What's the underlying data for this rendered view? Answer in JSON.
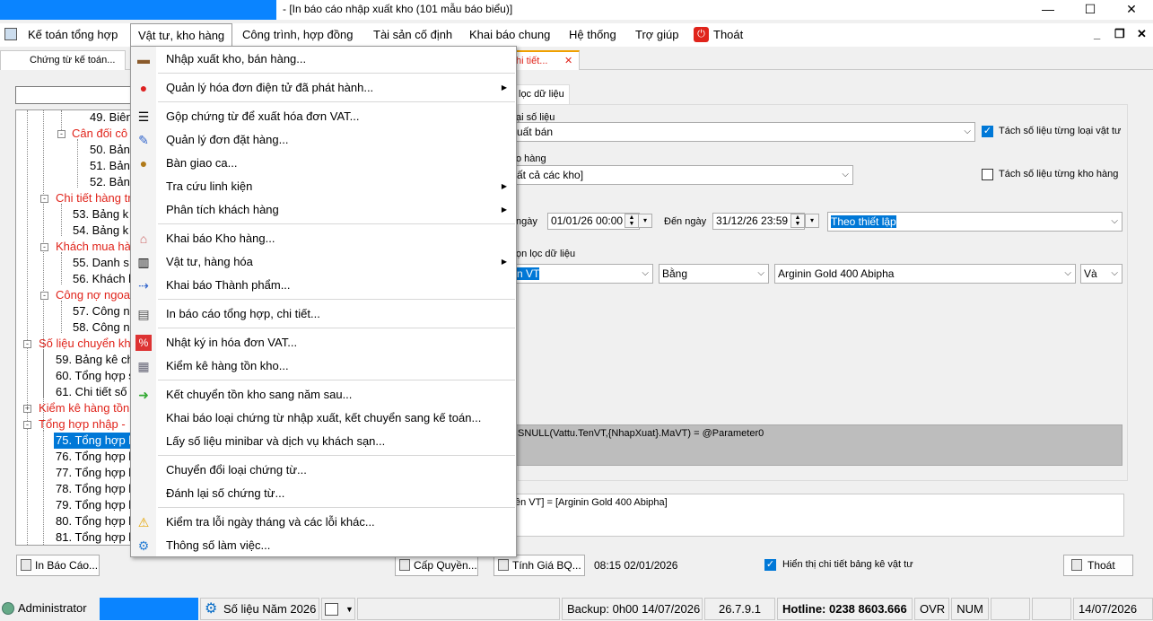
{
  "window": {
    "title": "- [In báo cáo nhập xuất kho (101 mẫu báo biểu)]",
    "minimize": "—",
    "maximize": "☐",
    "close": "✕"
  },
  "menubar": {
    "items": [
      "Kế toán tổng hợp",
      "Vật tư, kho hàng",
      "Công trình, hợp đồng",
      "Tài sản cố định",
      "Khai báo chung",
      "Hệ thống",
      "Trợ giúp",
      "Thoát"
    ],
    "mdi": [
      "_",
      "❐",
      "✕"
    ]
  },
  "tabs": {
    "first": "Chứng từ kế toán...",
    "second": "hi tiết...",
    "close": "✕"
  },
  "tree": {
    "nodes": [
      "49. Biên",
      "Cân đối cô",
      "50. Bản",
      "51. Bản",
      "52. Bản",
      "Chi tiết hàng tr",
      "53. Bảng k",
      "54. Bảng k",
      "Khách mua hà",
      "55. Danh s",
      "56. Khách l",
      "Công nợ ngoa",
      "57. Công n",
      "58. Công n",
      "Số liệu chuyển kh",
      "59. Bảng kê ch",
      "60. Tổng hợp s",
      "61. Chi tiết số l",
      "Kiểm kê hàng tồn",
      "Tổng hợp nhập - ",
      "75. Tổng hợp l",
      "76. Tổng hợp l",
      "77. Tổng hợp l",
      "78. Tổng hợp l",
      "79. Tổng hợp l",
      "80. Tổng hợp l",
      "81. Tổng hợp l"
    ]
  },
  "dropdown": {
    "items": [
      "Nhập xuất kho, bán hàng...",
      "Quản lý hóa đơn điện tử đã phát hành...",
      "Gộp chứng từ để xuất hóa đơn VAT...",
      "Quản lý đơn đặt hàng...",
      "Bàn giao ca...",
      "Tra cứu linh kiện",
      "Phân tích khách hàng",
      "Khai báo Kho hàng...",
      "Vật tư, hàng hóa",
      "Khai báo Thành phẩm...",
      "In báo cáo tổng hợp, chi tiết...",
      "Nhật ký in hóa đơn VAT...",
      "Kiểm kê hàng tồn kho...",
      "Kết chuyển tồn kho sang năm sau...",
      "Khai báo loại chứng từ nhập xuất, kết chuyển sang kế toán...",
      "Lấy số liệu minibar và dịch vụ khách sạn...",
      "Chuyển đổi loại chứng từ...",
      "Đánh lại số chứng từ...",
      "Kiểm tra lỗi ngày tháng và các lỗi khác...",
      "Thông số làm việc..."
    ],
    "submenu_arrow": "▶"
  },
  "filter": {
    "tab": "lọc dữ liệu",
    "group1_label": "ại số liệu",
    "type_value": "uất bán",
    "split_item_label": "Tách số liệu từng loại vật tư",
    "group2_label": "o hàng",
    "warehouse_value": "ất cả các kho]",
    "split_wh_label": "Tách số liệu từng kho hàng",
    "from_label": "ngày",
    "from_value": "01/01/26 00:00",
    "to_label": "Đến ngày",
    "to_value": "31/12/26 23:59",
    "period_value": "Theo thiết lập",
    "cond_label": "ọn lọc dữ liệu",
    "field_value": "n VT",
    "op_value": "Bằng",
    "val_value": "Arginin Gold 400 Abipha",
    "join_value": "Và",
    "sql": "ISNULL(Vattu.TenVT,{NhapXuat}.MaVT) = @Parameter0",
    "expr": "ên VT] = [Arginin Gold 400 Abipha]"
  },
  "buttons": {
    "print": "In Báo Cáo...",
    "grant": "Cấp Quyền...",
    "calc": "Tính Giá BQ...",
    "timestamp": "08:15 02/01/2026",
    "show_detail": "Hiển thị chi tiết bảng kê vật tư",
    "exit": "Thoát"
  },
  "status": {
    "user": "Administrator",
    "year": "Số liệu Năm 2026",
    "backup": "Backup: 0h00 14/07/2026",
    "version": "26.7.9.1",
    "hotline": "Hotline: 0238 8603.666",
    "ovr": "OVR",
    "num": "NUM",
    "date": "14/07/2026"
  },
  "colors": {
    "accent": "#0078d7",
    "title_blue": "#0a84ff",
    "red_node": "#e0241b"
  }
}
